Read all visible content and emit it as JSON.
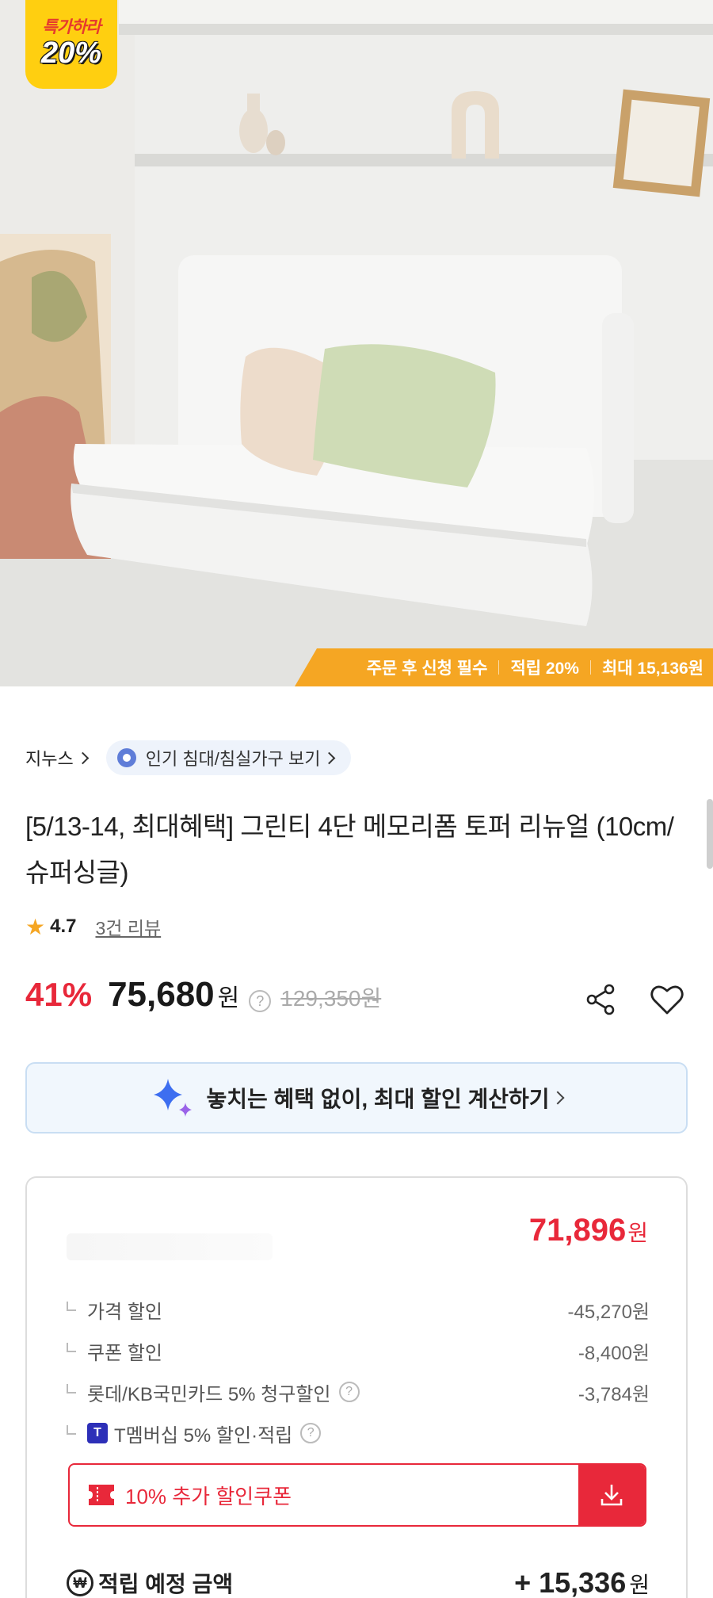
{
  "hero": {
    "badge_top": "특가하라",
    "badge_percent": "20%",
    "promo_strip": [
      "주문 후 신청 필수",
      "적립 20%",
      "최대 15,136원"
    ]
  },
  "breadcrumb": {
    "store": "지누스",
    "category": "인기 침대/침실가구 보기"
  },
  "product": {
    "title": "[5/13-14, 최대혜택] 그린티 4단 메모리폼 토퍼 리뉴얼 (10cm/슈퍼싱글)",
    "rating": "4.7",
    "reviews": "3건 리뷰",
    "discount": "41%",
    "price": "75,680",
    "won": "원",
    "original_price": "129,350원"
  },
  "benefit_banner": {
    "label": "놓치는 혜택 없이, 최대 할인 계산하기"
  },
  "calc": {
    "final_price": "71,896",
    "won": "원",
    "lines": [
      {
        "label": "가격 할인",
        "amount": "-45,270원"
      },
      {
        "label": "쿠폰 할인",
        "amount": "-8,400원"
      },
      {
        "label": "롯데/KB국민카드 5% 청구할인",
        "amount": "-3,784원"
      },
      {
        "label": "T멤버십 5% 할인·적립",
        "amount": ""
      }
    ],
    "coupon_label": "10% 추가 할인쿠폰",
    "points_label": "적립 예정 금액",
    "points_amount": "+ 15,336",
    "points_won": "원",
    "coin_symbol": "₩",
    "t_badge": "T",
    "help_symbol": "?"
  },
  "icons": {
    "share": "share-icon",
    "heart": "heart-icon",
    "sparkle": "sparkle-icon",
    "download": "download-icon",
    "ticket": "ticket-icon",
    "star": "star-icon",
    "medal": "medal-icon"
  },
  "colors": {
    "accent_red": "#e8283a",
    "promo_orange": "#f5a623",
    "badge_yellow": "#ffcf10",
    "banner_bg": "#f1f7fd"
  }
}
